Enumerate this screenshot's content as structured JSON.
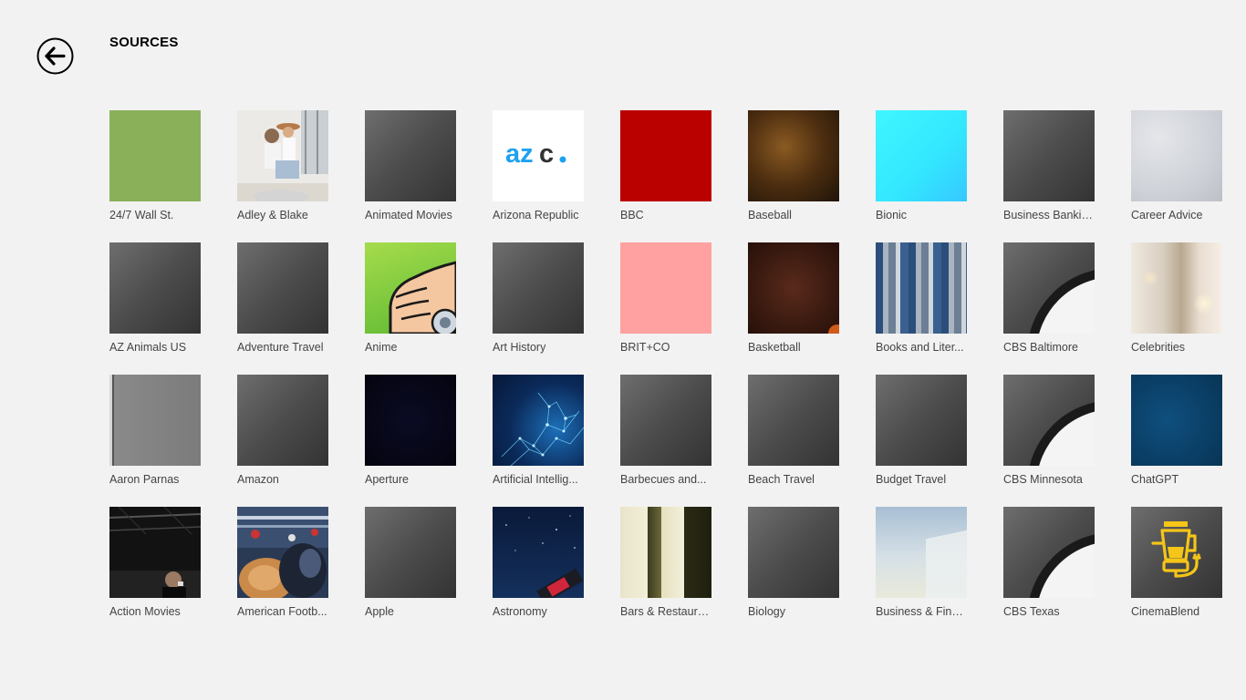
{
  "page": {
    "title": "SOURCES"
  },
  "sources": [
    {
      "label": "24/7 Wall St."
    },
    {
      "label": "AZ Animals US"
    },
    {
      "label": "Aaron Parnas"
    },
    {
      "label": "Action Movies"
    },
    {
      "label": "Adley & Blake"
    },
    {
      "label": "Adventure Travel"
    },
    {
      "label": "Amazon"
    },
    {
      "label": "American Footb..."
    },
    {
      "label": "Animated Movies"
    },
    {
      "label": "Anime"
    },
    {
      "label": "Aperture"
    },
    {
      "label": "Apple"
    },
    {
      "label": "Arizona Republic",
      "logo_text": "azc."
    },
    {
      "label": "Art History"
    },
    {
      "label": "Artificial Intellig..."
    },
    {
      "label": "Astronomy"
    },
    {
      "label": "BBC"
    },
    {
      "label": "BRIT+CO"
    },
    {
      "label": "Barbecues and..."
    },
    {
      "label": "Bars & Restaura..."
    },
    {
      "label": "Baseball"
    },
    {
      "label": "Basketball"
    },
    {
      "label": "Beach Travel"
    },
    {
      "label": "Biology"
    },
    {
      "label": "Bionic"
    },
    {
      "label": "Books and Liter..."
    },
    {
      "label": "Budget Travel"
    },
    {
      "label": "Business & Fina..."
    },
    {
      "label": "Business Bankin..."
    },
    {
      "label": "CBS Baltimore"
    },
    {
      "label": "CBS Minnesota"
    },
    {
      "label": "CBS Texas"
    },
    {
      "label": "Career Advice"
    },
    {
      "label": "Celebrities"
    },
    {
      "label": "ChatGPT"
    },
    {
      "label": "CinemaBlend"
    }
  ],
  "colors": {
    "background": "#f2f2f2",
    "azc_blue": "#1ea1f2",
    "bbc_red": "#bb0000",
    "brit_pink": "#ffa1a1",
    "bionic_cyan": "#33f0ff",
    "wallst_green": "#8ab05a",
    "cinemablend_yellow": "#f5c518"
  }
}
